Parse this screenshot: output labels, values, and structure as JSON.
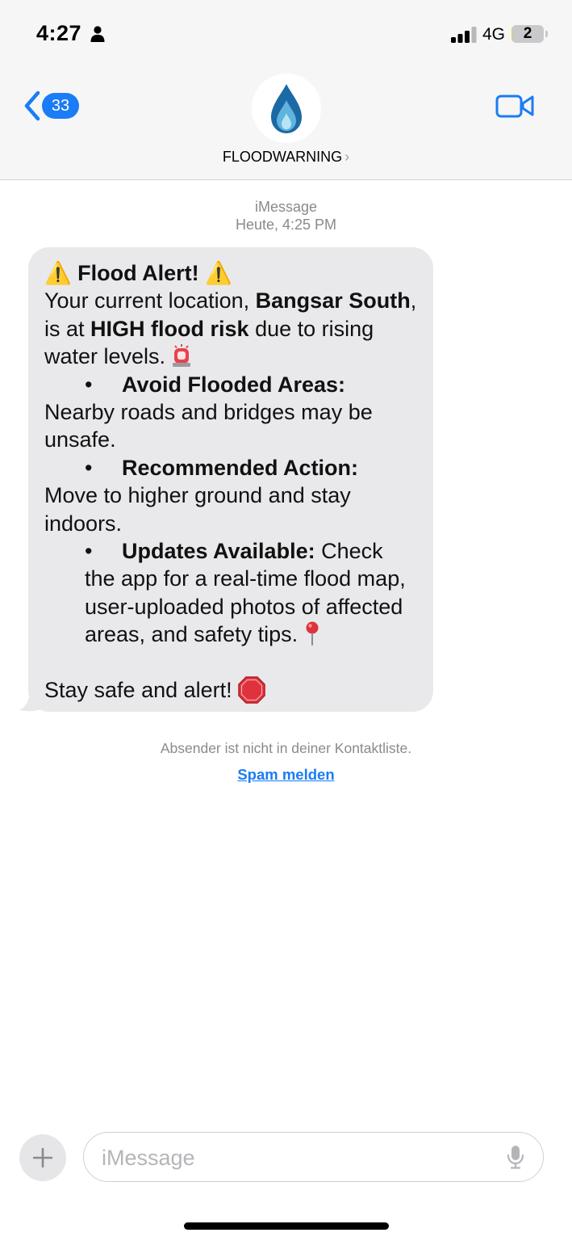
{
  "status_bar": {
    "time": "4:27",
    "network": "4G",
    "battery_level": "2",
    "battery_fill_percent": 2,
    "battery_color": "#f2cf3e",
    "icons": [
      "person-icon",
      "signal-bars-icon",
      "battery-icon"
    ]
  },
  "nav": {
    "back_badge_count": "33",
    "back_icon": "chevron-left-icon",
    "video_icon": "video-camera-icon",
    "contact_name": "FLOODWARNING",
    "contact_chevron": "›",
    "avatar_icon": "water-drop-icon",
    "accent_color": "#1a7cf6"
  },
  "thread": {
    "service": "iMessage",
    "timestamp": "Heute, 4:25 PM"
  },
  "message": {
    "title_emoji": "⚠️",
    "title": "Flood Alert!",
    "intro_prefix": "Your current location,",
    "location": "Bangsar South",
    "intro_middle": ", is at",
    "risk": "HIGH flood risk",
    "intro_suffix": "due to rising water levels.",
    "siren_icon": "police-siren-icon",
    "bullet_char": "•",
    "bullets": [
      {
        "heading": "Avoid Flooded Areas:",
        "text": "Nearby roads and bridges may be unsafe."
      },
      {
        "heading": "Recommended Action:",
        "text": "Move to higher ground and stay indoors."
      },
      {
        "heading": "Updates Available:",
        "text": "Check the app for a real-time flood map, user-uploaded photos of affected areas, and safety tips."
      }
    ],
    "pin_icon": "round-pushpin-icon",
    "closing": "Stay safe and alert!",
    "stop_icon": "stop-sign-icon",
    "bubble_color": "#e9e9eb"
  },
  "footer_notice": {
    "not_in_contacts": "Absender ist nicht in deiner Kontaktliste.",
    "report_link": "Spam melden"
  },
  "composer": {
    "plus_icon": "plus-icon",
    "placeholder": "iMessage",
    "value": "",
    "mic_icon": "microphone-icon"
  }
}
